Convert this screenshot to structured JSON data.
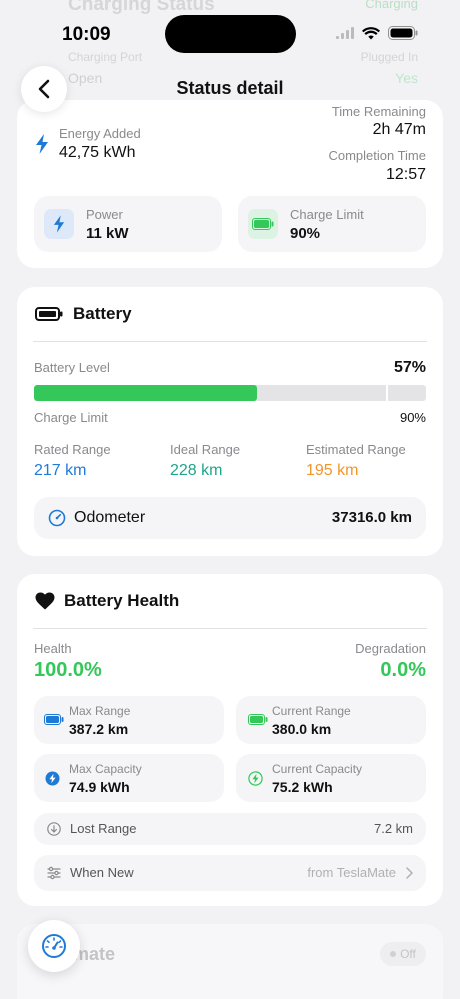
{
  "ghost": {
    "title": "Charging Status",
    "badge": "Charging",
    "row1_left": "Charging Port",
    "row1_right": "Plugged In",
    "row2_left": "Open",
    "row2_right": "Yes"
  },
  "status_bar": {
    "time": "10:09"
  },
  "nav": {
    "title": "Status detail"
  },
  "charging": {
    "energy_label": "Energy Added",
    "energy_value": "42,75 kWh",
    "time_remaining_label": "Time Remaining",
    "time_remaining_value": "2h 47m",
    "completion_label": "Completion Time",
    "completion_value": "12:57",
    "power_label": "Power",
    "power_value": "11 kW",
    "charge_limit_label": "Charge Limit",
    "charge_limit_value": "90%"
  },
  "battery": {
    "title": "Battery",
    "level_label": "Battery Level",
    "level_value": "57%",
    "level_fraction": 0.57,
    "limit_fraction": 0.9,
    "charge_limit_label": "Charge Limit",
    "charge_limit_value": "90%",
    "rated_label": "Rated Range",
    "rated_value": "217 km",
    "ideal_label": "Ideal Range",
    "ideal_value": "228 km",
    "estimated_label": "Estimated Range",
    "estimated_value": "195 km",
    "odometer_label": "Odometer",
    "odometer_value": "37316.0 km"
  },
  "health": {
    "title": "Battery Health",
    "health_label": "Health",
    "health_value": "100.0%",
    "degradation_label": "Degradation",
    "degradation_value": "0.0%",
    "max_range_label": "Max Range",
    "max_range_value": "387.2 km",
    "current_range_label": "Current Range",
    "current_range_value": "380.0 km",
    "max_capacity_label": "Max Capacity",
    "max_capacity_value": "74.9 kWh",
    "current_capacity_label": "Current Capacity",
    "current_capacity_value": "75.2 kWh",
    "lost_range_label": "Lost Range",
    "lost_range_value": "7.2 km",
    "when_new_label": "When New",
    "when_new_value": "from TeslaMate"
  },
  "bottom": {
    "title": "mate",
    "toggle_label": "Off"
  },
  "colors": {
    "green": "#34c759",
    "blue": "#1f7ad6",
    "teal": "#1fa58a",
    "orange": "#f0962d"
  }
}
